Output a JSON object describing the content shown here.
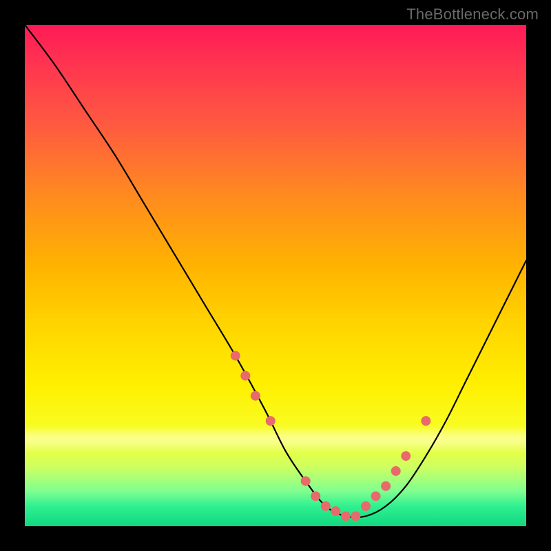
{
  "attribution": "TheBottleneck.com",
  "chart_data": {
    "type": "line",
    "title": "",
    "xlabel": "",
    "ylabel": "",
    "xlim": [
      0,
      100
    ],
    "ylim": [
      0,
      100
    ],
    "curve": {
      "x": [
        0,
        6,
        12,
        18,
        24,
        30,
        36,
        42,
        48,
        52,
        56,
        60,
        64,
        68,
        72,
        76,
        80,
        84,
        88,
        92,
        96,
        100
      ],
      "y": [
        100,
        92,
        83,
        74,
        64,
        54,
        44,
        34,
        23,
        15,
        9,
        4,
        2,
        2,
        4,
        8,
        14,
        21,
        29,
        37,
        45,
        53
      ]
    },
    "markers": {
      "x": [
        42,
        44,
        46,
        49,
        56,
        58,
        60,
        62,
        64,
        66,
        68,
        70,
        72,
        74,
        76,
        80
      ],
      "y": [
        34,
        30,
        26,
        21,
        9,
        6,
        4,
        3,
        2,
        2,
        4,
        6,
        8,
        11,
        14,
        21
      ]
    },
    "colors": {
      "curve": "#000000",
      "marker_fill": "#e86a6a",
      "marker_stroke": "#c94f4f"
    }
  }
}
